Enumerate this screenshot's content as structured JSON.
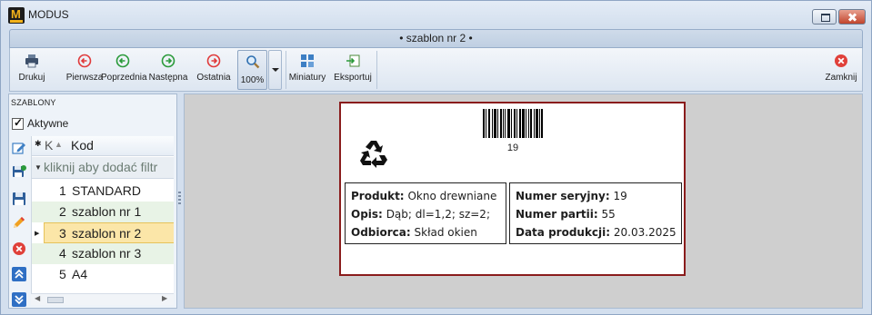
{
  "window": {
    "app_logo_text": "M",
    "title": "MODUS"
  },
  "document_tab": {
    "title": "• szablon nr 2 •"
  },
  "toolbar": {
    "print_label": "Drukuj",
    "first_label": "Pierwsza",
    "previous_label": "Poprzednia",
    "next_label": "Następna",
    "last_label": "Ostatnia",
    "zoom_value": "100%",
    "thumbnails_label": "Miniatury",
    "export_label": "Eksportuj",
    "close_label": "Zamknij"
  },
  "templates_panel": {
    "header": "SZABLONY",
    "active_checkbox_label": "Aktywne",
    "active_checked": true,
    "grid": {
      "column_header_short": "K",
      "column_header": "Kod",
      "filter_placeholder": "kliknij aby dodać filtr",
      "rows": [
        {
          "number": "1",
          "name": "STANDARD"
        },
        {
          "number": "2",
          "name": "szablon nr 1"
        },
        {
          "number": "3",
          "name": "szablon nr 2"
        },
        {
          "number": "4",
          "name": "szablon nr 3"
        },
        {
          "number": "5",
          "name": "A4"
        }
      ],
      "selected_index": 2
    }
  },
  "label_preview": {
    "barcode_number": "19",
    "left_box": {
      "product_label": "Produkt:",
      "product_value": "Okno drewniane",
      "description_label": "Opis:",
      "description_value": "Dąb; dl=1,2; sz=2;",
      "recipient_label": "Odbiorca:",
      "recipient_value": "Skład okien"
    },
    "right_box": {
      "serial_label": "Numer seryjny:",
      "serial_value": "19",
      "batch_label": "Numer partii:",
      "batch_value": "55",
      "production_date_label": "Data produkcji:",
      "production_date_value": "20.03.2025"
    }
  },
  "colors": {
    "window_background": "#d3dfee",
    "label_border": "#8a1c1c",
    "selected_row": "#fbe6a8",
    "alt_row": "#e8f3e6",
    "nav_red": "#e03a3a",
    "nav_green": "#2a9a3a",
    "close_red": "#e0403a"
  }
}
